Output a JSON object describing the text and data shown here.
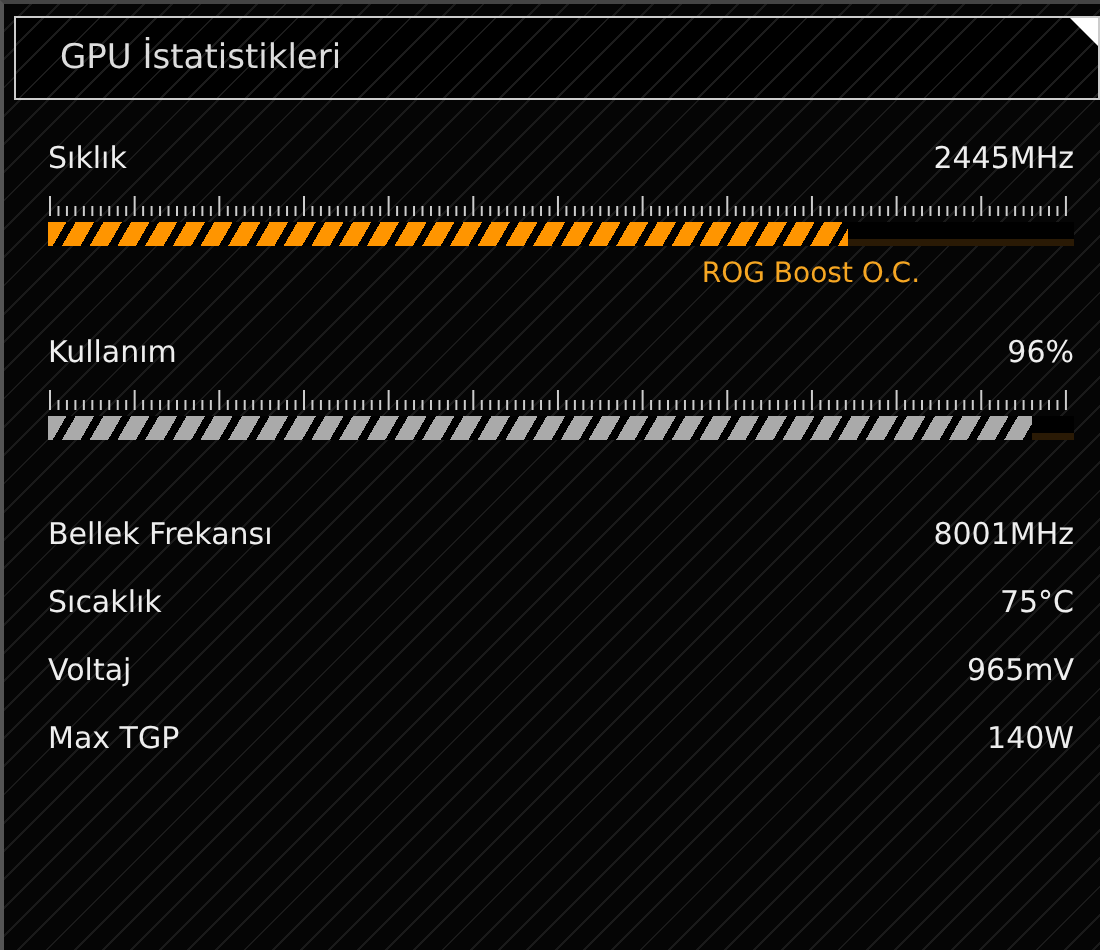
{
  "panel": {
    "title": "GPU İstatistikleri"
  },
  "meters": [
    {
      "kind": "boost",
      "label": "Sıklık",
      "reading": "2445MHz",
      "level": 0.78,
      "note": "ROG Boost O.C."
    },
    {
      "kind": "plain",
      "label": "Kullanım",
      "reading": "96%",
      "level": 0.96
    }
  ],
  "stats": [
    {
      "label": "Bellek Frekansı",
      "value": "8001MHz"
    },
    {
      "label": "Sıcaklık",
      "value": "75°C"
    },
    {
      "label": "Voltaj",
      "value": "965mV"
    },
    {
      "label": "Max TGP",
      "value": "140W"
    }
  ]
}
